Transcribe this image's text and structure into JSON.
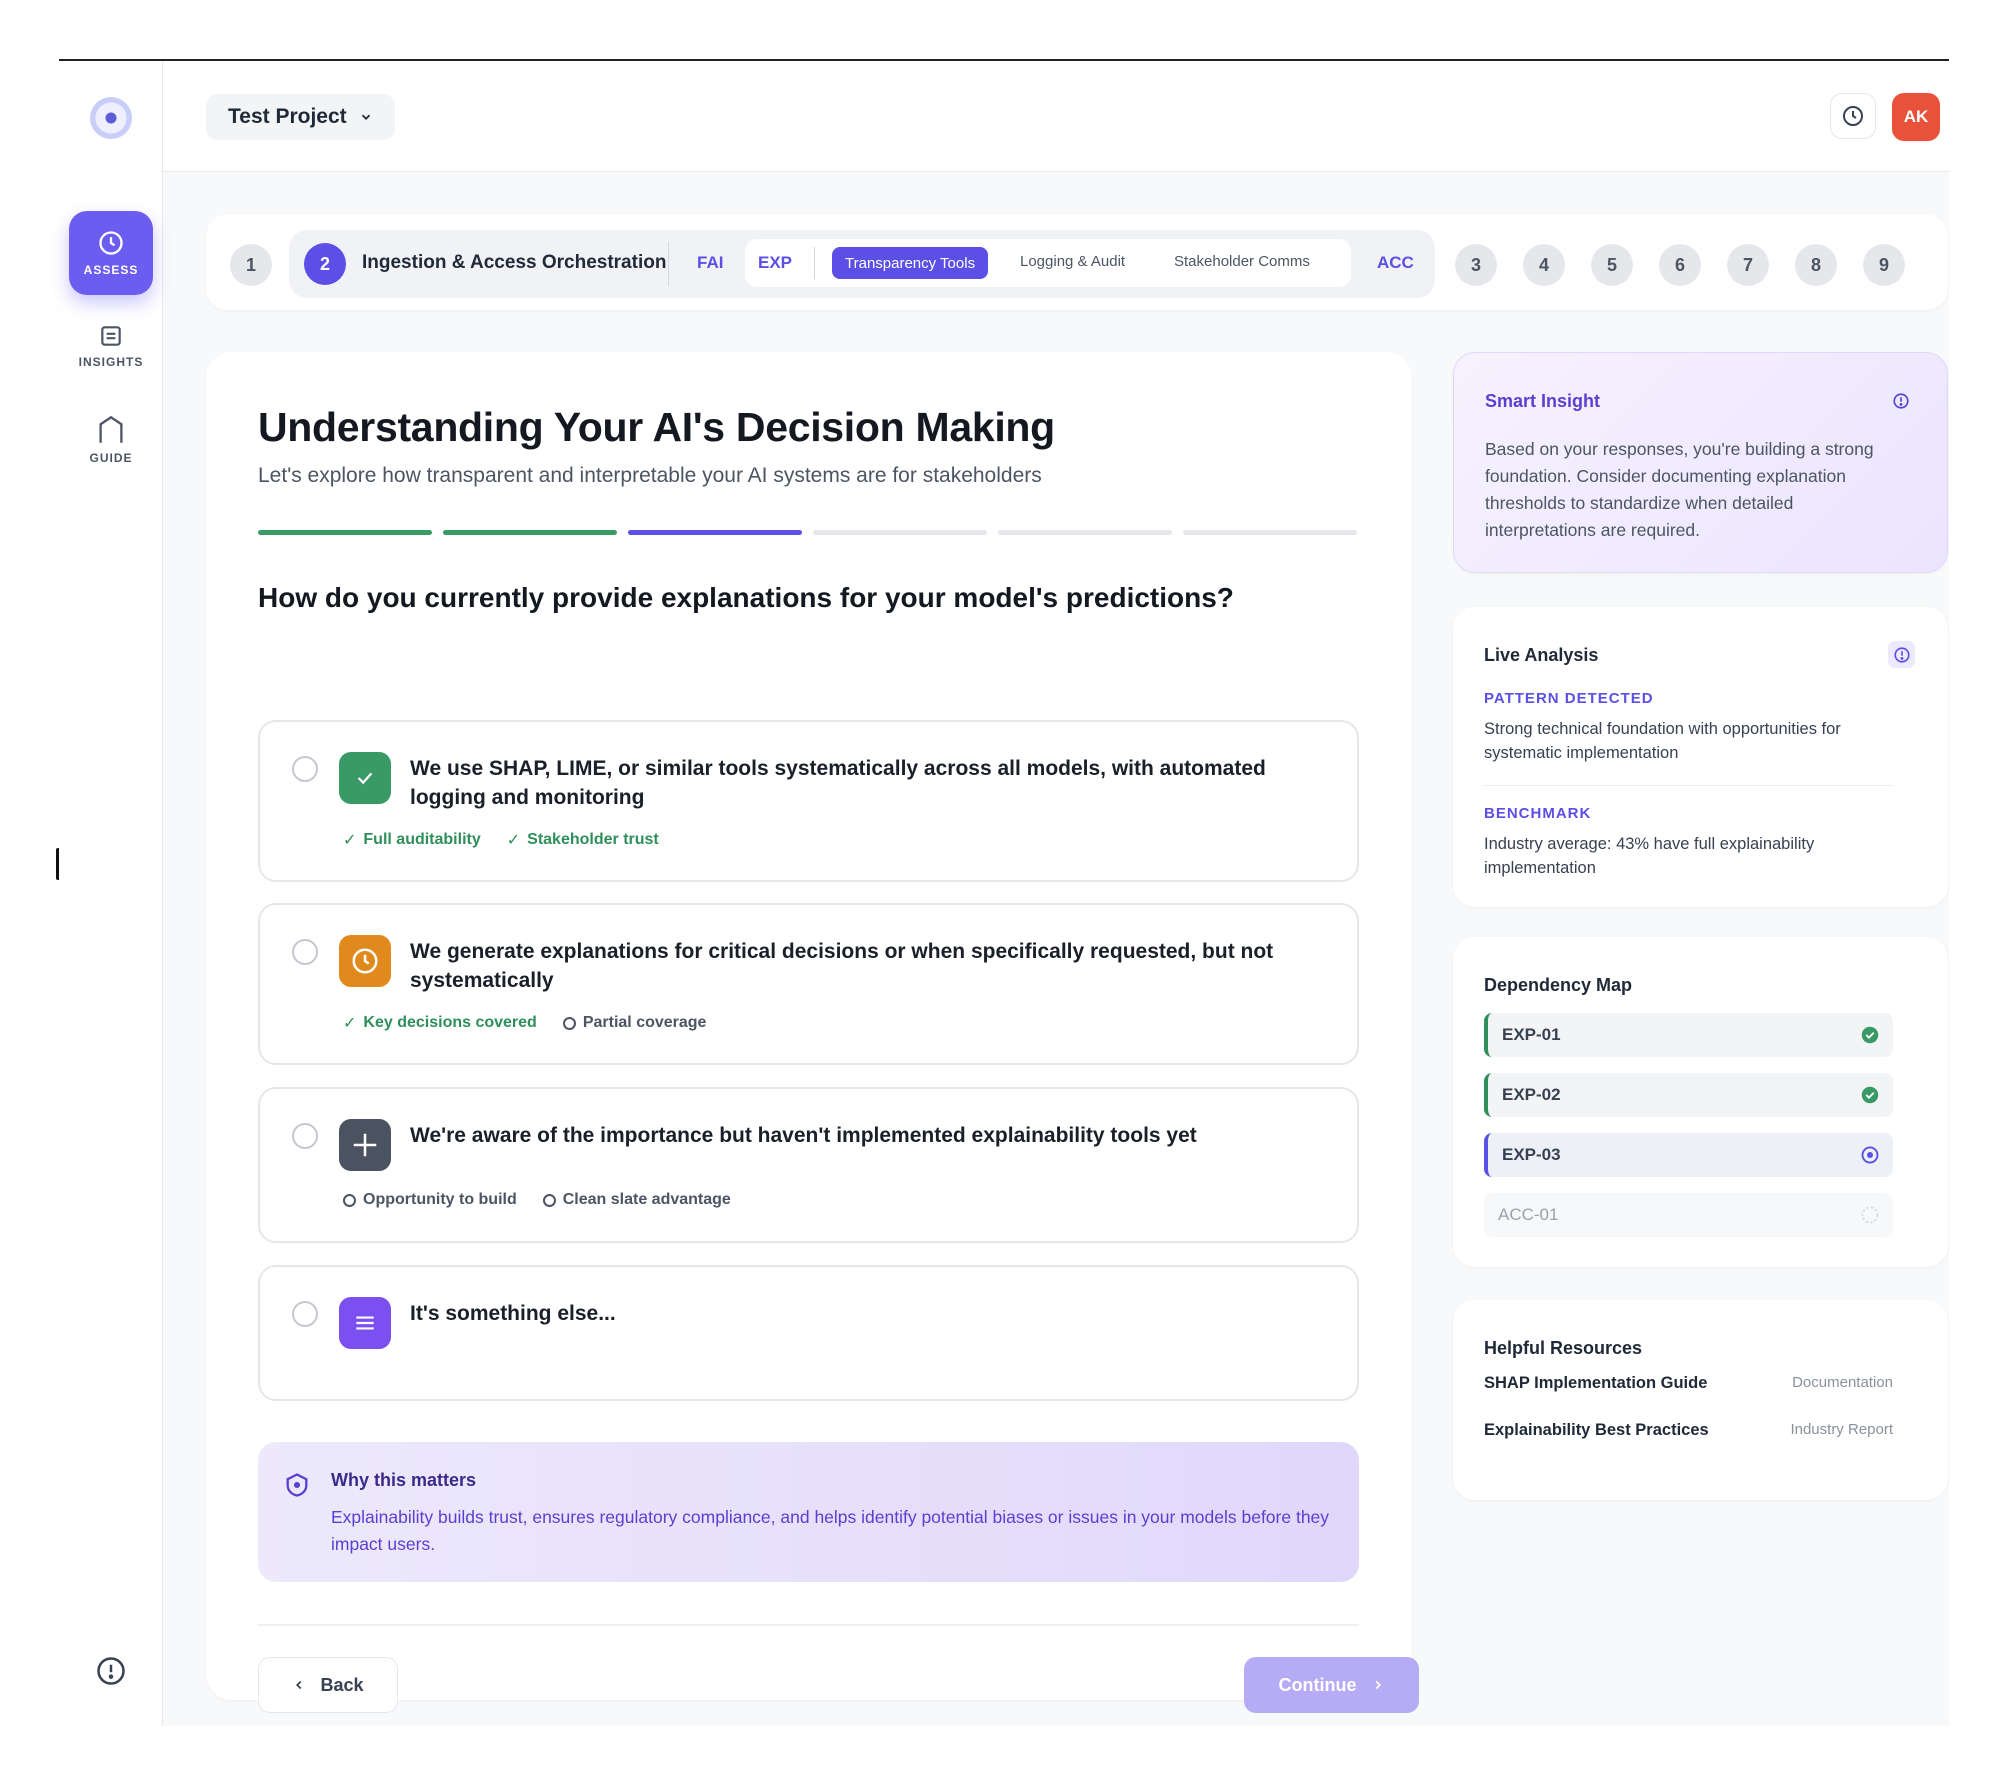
{
  "project": {
    "name": "Test Project"
  },
  "user": {
    "initials": "AK"
  },
  "sidebar": {
    "items": [
      {
        "label": "ASSESS",
        "icon": "clock-icon",
        "active": true
      },
      {
        "label": "INSIGHTS",
        "icon": "document-icon",
        "active": false
      },
      {
        "label": "GUIDE",
        "icon": "shield-icon",
        "active": false
      }
    ]
  },
  "stepper": {
    "steps": [
      "1",
      "2",
      "3",
      "4",
      "5",
      "6",
      "7",
      "8",
      "9"
    ],
    "active_step": "2",
    "active_title": "Ingestion & Access Orchestration",
    "subsections": [
      "FAI",
      "EXP",
      "ACC"
    ],
    "exp_tabs": [
      "Transparency Tools",
      "Logging & Audit",
      "Stakeholder Comms"
    ],
    "active_tab": "Transparency Tools"
  },
  "main": {
    "title": "Understanding Your AI's Decision Making",
    "subtitle": "Let's explore how transparent and interpretable your AI systems are for stakeholders",
    "progress": {
      "total_segments": 6,
      "completed": 2,
      "current": 3
    },
    "question": "How do you currently provide explanations for your model's predictions?",
    "options": [
      {
        "text": "We use SHAP, LIME, or similar tools systematically across all models, with automated logging and monitoring",
        "icon": "check-icon",
        "color": "#3a9a66",
        "tags": [
          {
            "label": "Full auditability",
            "kind": "good"
          },
          {
            "label": "Stakeholder trust",
            "kind": "good"
          }
        ]
      },
      {
        "text": "We generate explanations for critical decisions or when specifically requested, but not systematically",
        "icon": "clock-icon",
        "color": "#e08a1e",
        "tags": [
          {
            "label": "Key decisions covered",
            "kind": "good"
          },
          {
            "label": "Partial coverage",
            "kind": "neutral"
          }
        ]
      },
      {
        "text": "We're aware of the importance but haven't implemented explainability tools yet",
        "icon": "plus-icon",
        "color": "#4b5260",
        "tags": [
          {
            "label": "Opportunity to build",
            "kind": "neutral"
          },
          {
            "label": "Clean slate advantage",
            "kind": "neutral"
          }
        ]
      },
      {
        "text": "It's something else...",
        "icon": "menu-icon",
        "color": "#7b4ff0",
        "tags": []
      }
    ],
    "why": {
      "title": "Why this matters",
      "text": "Explainability builds trust, ensures regulatory compliance, and helps identify potential biases or issues in your models before they impact users."
    },
    "back_label": "Back",
    "continue_label": "Continue"
  },
  "smart_insight": {
    "title": "Smart Insight",
    "text": "Based on your responses, you're building a strong foundation. Consider documenting explanation thresholds to standardize when detailed interpretations are required."
  },
  "live_analysis": {
    "title": "Live Analysis",
    "items": [
      {
        "label": "PATTERN DETECTED",
        "text": "Strong technical foundation with opportunities for systematic implementation"
      },
      {
        "label": "BENCHMARK",
        "text": "Industry average: 43% have full explainability implementation"
      }
    ]
  },
  "dependency_map": {
    "title": "Dependency Map",
    "items": [
      {
        "code": "EXP-01",
        "status": "complete"
      },
      {
        "code": "EXP-02",
        "status": "complete"
      },
      {
        "code": "EXP-03",
        "status": "current"
      },
      {
        "code": "ACC-01",
        "status": "pending"
      }
    ]
  },
  "resources": {
    "title": "Helpful Resources",
    "items": [
      {
        "name": "SHAP Implementation Guide",
        "type": "Documentation"
      },
      {
        "name": "Explainability Best Practices",
        "type": "Industry Report"
      }
    ]
  },
  "colors": {
    "accent": "#5b4fe6",
    "success": "#2f8f5b",
    "avatar": "#e9523a"
  }
}
